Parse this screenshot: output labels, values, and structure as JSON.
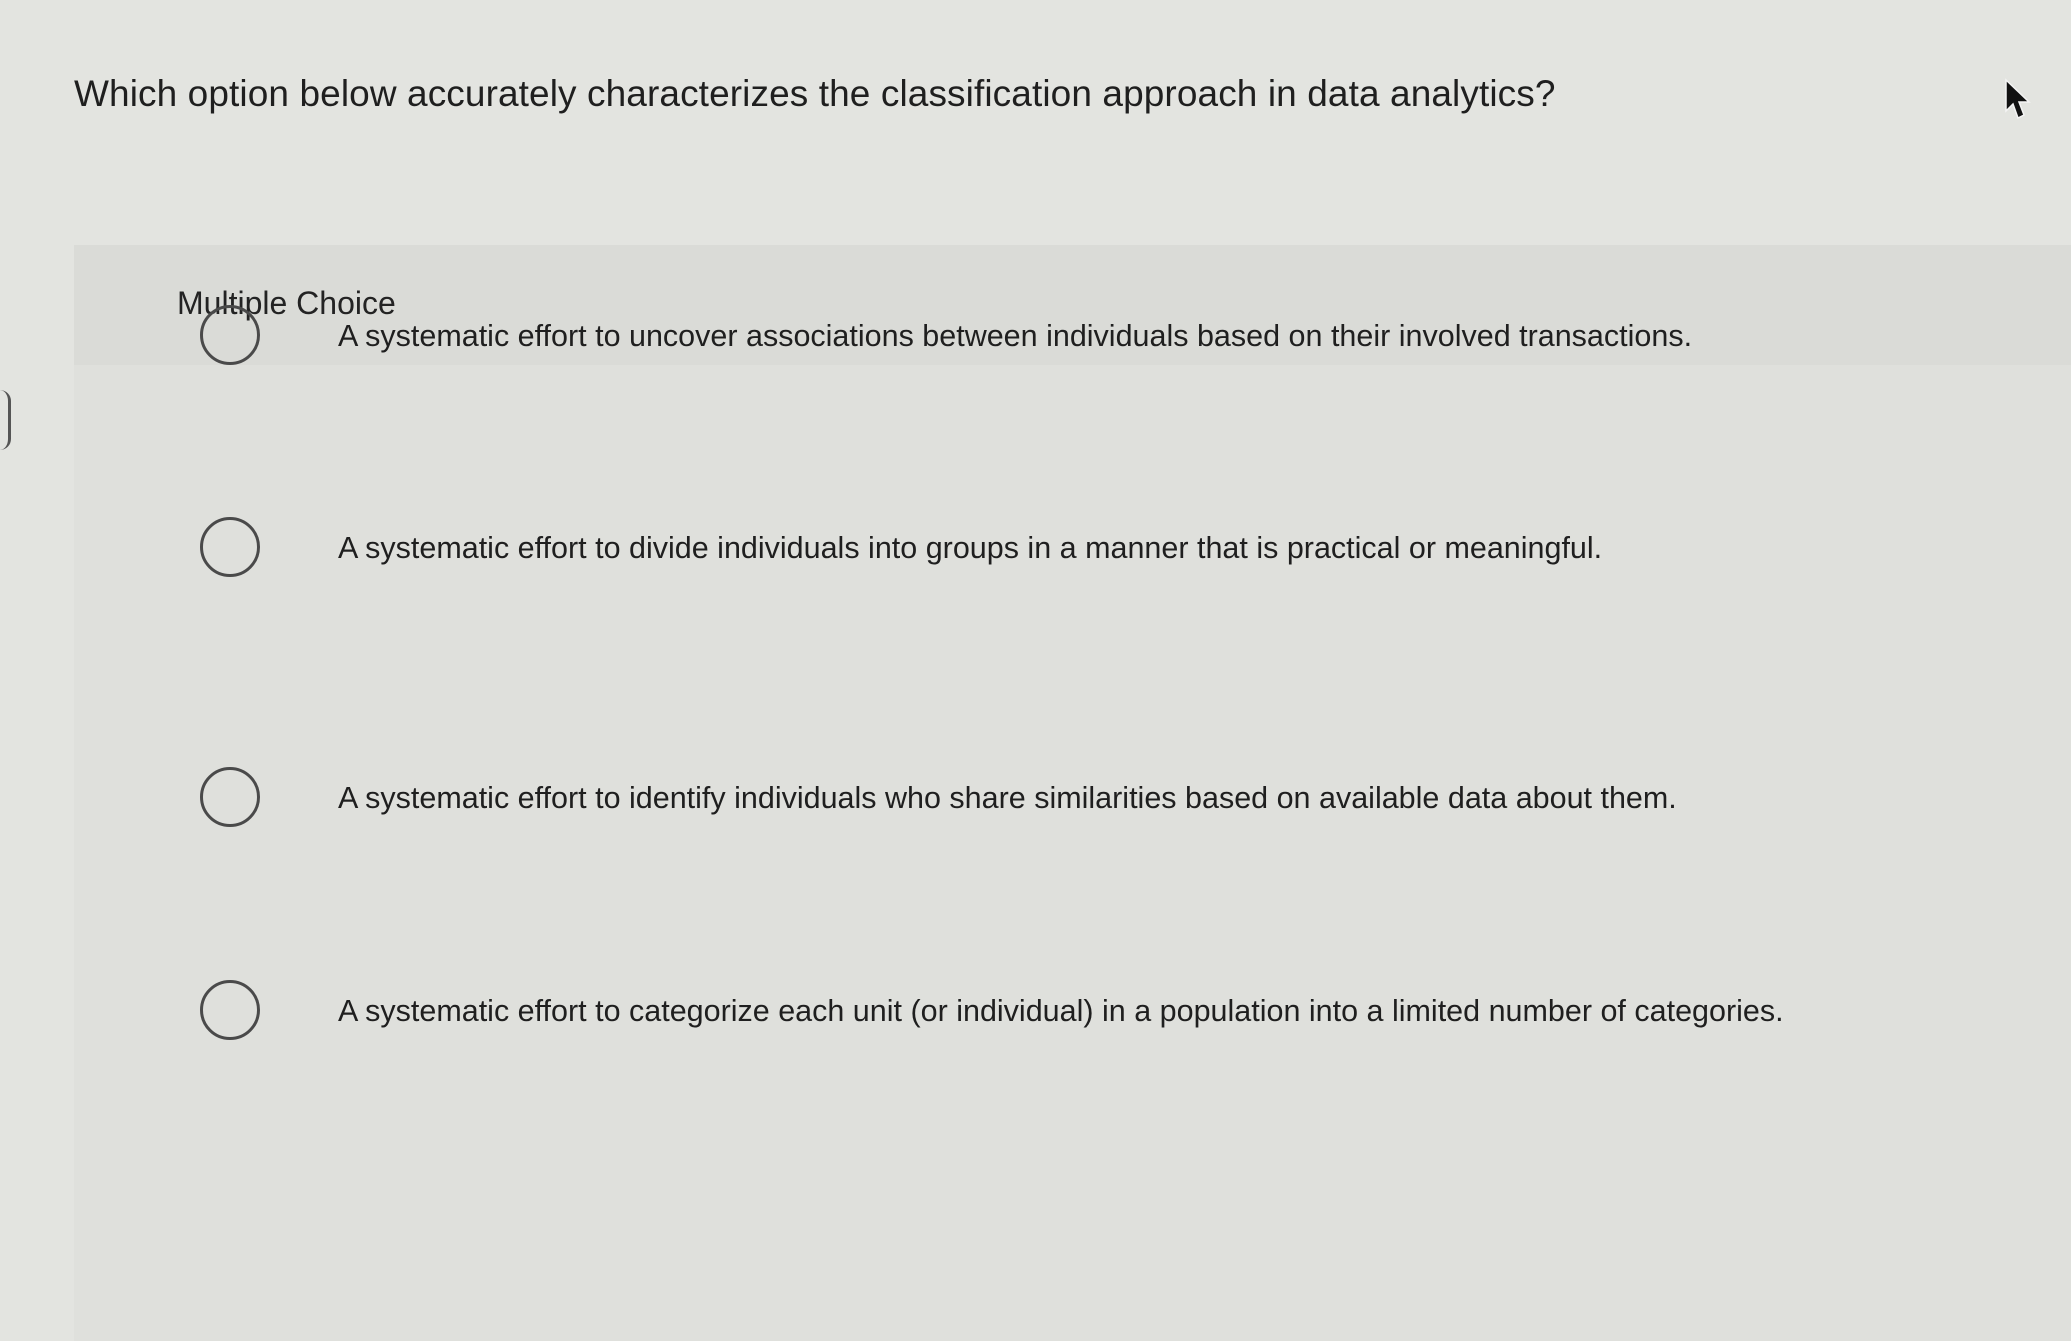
{
  "question": {
    "text": "Which option below accurately characterizes the classification approach in data analytics?"
  },
  "panel": {
    "label": "Multiple Choice"
  },
  "options": [
    {
      "text": "A systematic effort to uncover associations between individuals based on their involved transactions.",
      "selected": false
    },
    {
      "text": "A systematic effort to divide individuals into groups in a manner that is practical or meaningful.",
      "selected": false
    },
    {
      "text": "A systematic effort to identify individuals who share similarities based on available data about them.",
      "selected": false
    },
    {
      "text": "A systematic effort to categorize each unit (or individual) in a population into a limited number of categories.",
      "selected": false
    }
  ],
  "icons": {
    "cursor": "mouse-pointer-icon",
    "radio": "radio-button-icon"
  }
}
